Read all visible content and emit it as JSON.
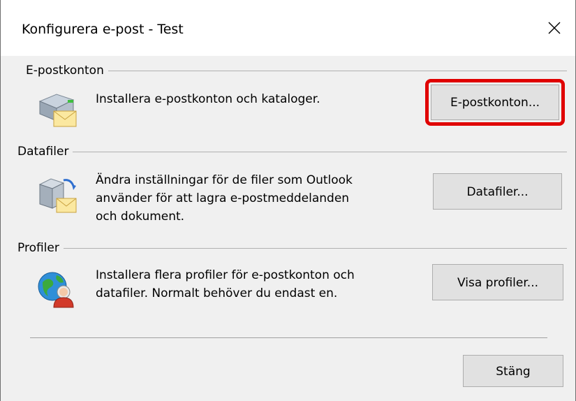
{
  "window": {
    "title": "Konfigurera e-post - Test",
    "close_glyph": "✕"
  },
  "email_accounts": {
    "group_label": "E-postkonton",
    "icon": "email-accounts-icon",
    "description": "Installera e-postkonton och kataloger.",
    "button_label": "E-postkonton...",
    "highlight_color": "#e00000"
  },
  "data_files": {
    "group_label": "Datafiler",
    "icon": "data-files-icon",
    "description_lines": [
      "Ändra inställningar för de filer som Outlook",
      "använder för att lagra e-postmeddelanden",
      "och dokument."
    ],
    "button_label": "Datafiler..."
  },
  "profiles": {
    "group_label": "Profiler",
    "icon": "profiles-icon",
    "description_lines": [
      "Installera flera profiler för e-postkonton och",
      "datafiler. Normalt behöver du endast en."
    ],
    "button_label": "Visa profiler..."
  },
  "footer": {
    "close_button_label": "Stäng"
  }
}
